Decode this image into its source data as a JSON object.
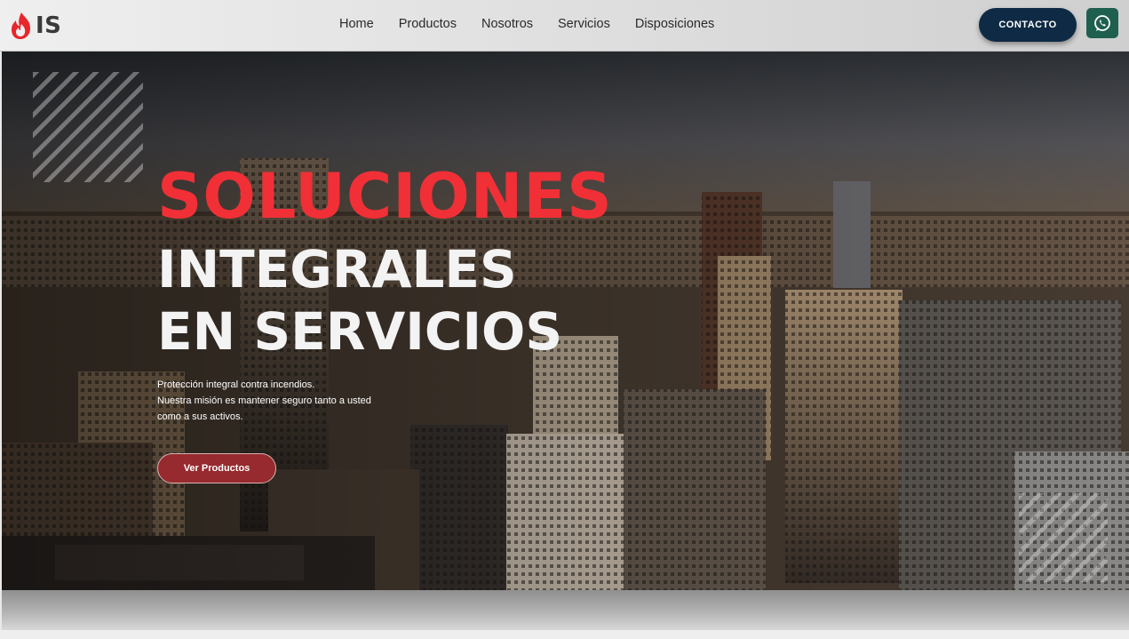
{
  "brand": {
    "logo_text": "IS",
    "logo_icon": "flame-icon",
    "accent": "#e8262b"
  },
  "nav": {
    "items": [
      "Home",
      "Productos",
      "Nosotros",
      "Servicios",
      "Disposiciones"
    ]
  },
  "header": {
    "contact_label": "CONTACTO",
    "contact_color": "#0f2a44",
    "whatsapp_icon": "whatsapp-icon",
    "whatsapp_color": "#1f5f4f"
  },
  "hero": {
    "headline_1": "SOLUCIONES",
    "headline_2": "INTEGRALES",
    "headline_3": "EN SERVICIOS",
    "headline_1_color": "#f03036",
    "description": [
      "Protección integral contra incendios.",
      "Nuestra misión es mantener seguro tanto a usted",
      "como a sus activos."
    ],
    "cta_label": "Ver Productos",
    "cta_color": "#962a2e"
  }
}
